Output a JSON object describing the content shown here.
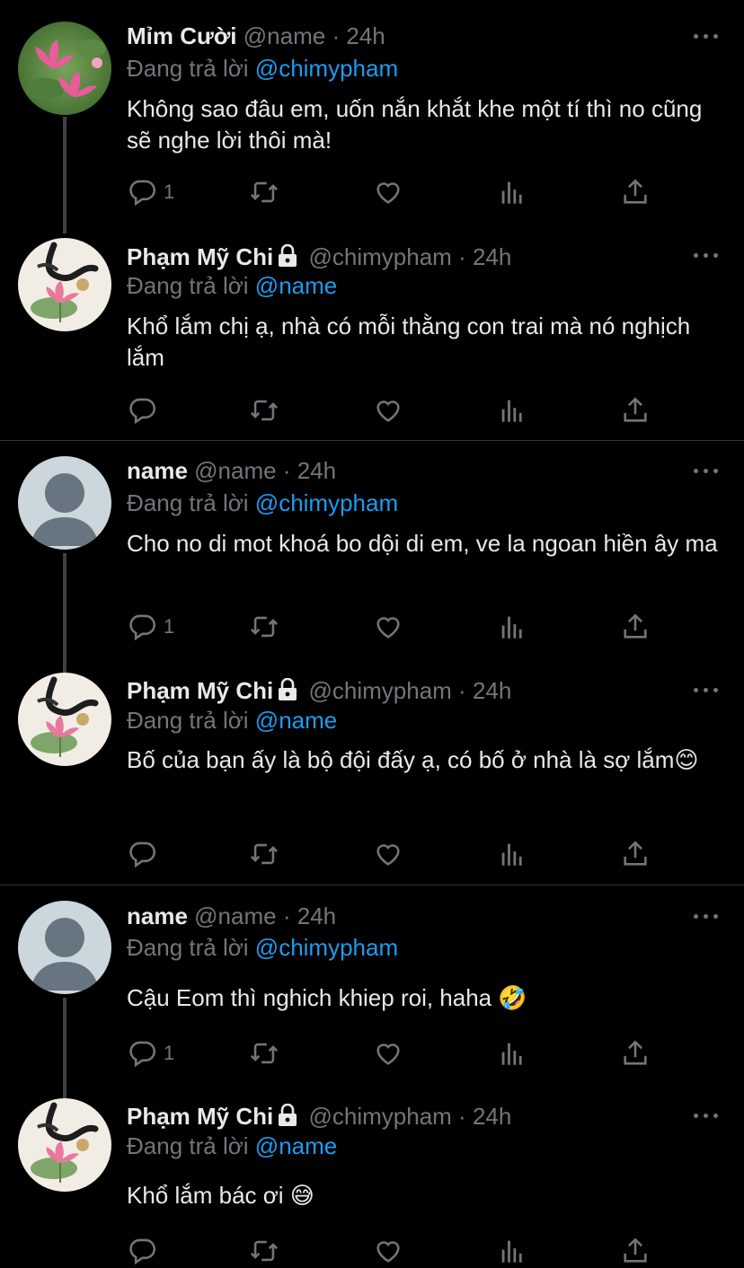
{
  "replying_prefix": "Đang trả lời",
  "tweets": [
    {
      "name": "Mỉm Cười",
      "locked": false,
      "handle": "@name",
      "dot": "·",
      "time": "24h",
      "reply_to": "@chimypham",
      "text": "Không sao đâu em, uốn nắn khắt khe một tí thì no cũng sẽ nghe lời thôi mà!",
      "reply_count": "1",
      "avatar": "lotus-photo"
    },
    {
      "name": "Phạm Mỹ Chi",
      "locked": true,
      "handle": "@chimypham",
      "dot": "·",
      "time": "24h",
      "reply_to": "@name",
      "text": "Khổ lắm chị ạ, nhà có mỗi thằng con trai mà nó nghịch lắm",
      "reply_count": "",
      "avatar": "lotus-painting"
    },
    {
      "name": "name",
      "locked": false,
      "handle": "@name",
      "dot": "·",
      "time": "24h",
      "reply_to": "@chimypham",
      "text": "Cho no di mot khoá bo dội di em, ve la ngoan hiền ây ma",
      "reply_count": "1",
      "avatar": "default-profile"
    },
    {
      "name": "Phạm Mỹ Chi",
      "locked": true,
      "handle": "@chimypham",
      "dot": "·",
      "time": "24h",
      "reply_to": "@name",
      "text": "Bố của bạn ấy là bộ đội đấy ạ, có bố ở nhà là sợ lắm😊",
      "reply_count": "",
      "avatar": "lotus-painting"
    },
    {
      "name": "name",
      "locked": false,
      "handle": "@name",
      "dot": "·",
      "time": "24h",
      "reply_to": "@chimypham",
      "text": "Cậu Eom thì nghich khiep roi, haha 🤣",
      "reply_count": "1",
      "avatar": "default-profile"
    },
    {
      "name": "Phạm Mỹ Chi",
      "locked": true,
      "handle": "@chimypham",
      "dot": "·",
      "time": "24h",
      "reply_to": "@name",
      "text": "Khổ lắm bác ơi 😅",
      "reply_count": "",
      "avatar": "lotus-painting"
    }
  ],
  "icons": {
    "reply": "reply-icon",
    "retweet": "retweet-icon",
    "like": "like-icon",
    "views": "views-icon",
    "share": "share-icon",
    "more": "more-icon",
    "lock": "lock-icon"
  },
  "colors": {
    "background": "#000000",
    "text": "#e7e9ea",
    "muted": "#71767b",
    "mention": "#1d9bf0",
    "thread_line": "#3e4144",
    "divider": "#2f3336"
  }
}
